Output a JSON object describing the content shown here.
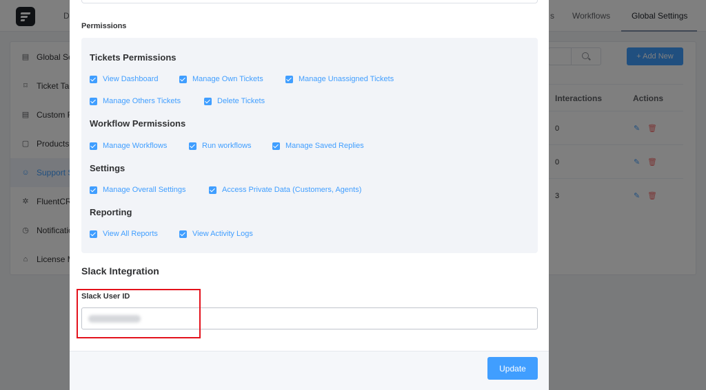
{
  "topnav": {
    "tabs": [
      {
        "label": "Da"
      },
      {
        "label": "s"
      },
      {
        "label": "Workflows"
      },
      {
        "label": "Global Settings"
      }
    ]
  },
  "sidebar": {
    "items": [
      {
        "label": "Global Se",
        "icon": "document-icon"
      },
      {
        "label": "Ticket Tag",
        "icon": "bookmark-icon"
      },
      {
        "label": "Custom F",
        "icon": "form-icon"
      },
      {
        "label": "Products",
        "icon": "box-icon"
      },
      {
        "label": "Support S",
        "icon": "user-icon"
      },
      {
        "label": "FluentCRM",
        "icon": "gear-icon"
      },
      {
        "label": "Notificatio",
        "icon": "alarm-icon"
      },
      {
        "label": "License M",
        "icon": "lock-icon"
      }
    ]
  },
  "toolbar": {
    "add_new_label": "+ Add New"
  },
  "table": {
    "headers": [
      "Interactions",
      "Actions"
    ],
    "rows": [
      {
        "interactions": "0"
      },
      {
        "interactions": "0"
      },
      {
        "interactions": "3"
      }
    ]
  },
  "modal": {
    "permissions_label": "Permissions",
    "groups": [
      {
        "title": "Tickets Permissions",
        "items": [
          "View Dashboard",
          "Manage Own Tickets",
          "Manage Unassigned Tickets",
          "Manage Others Tickets",
          "Delete Tickets"
        ]
      },
      {
        "title": "Workflow Permissions",
        "items": [
          "Manage Workflows",
          "Run workflows",
          "Manage Saved Replies"
        ]
      },
      {
        "title": "Settings",
        "items": [
          "Manage Overall Settings",
          "Access Private Data (Customers, Agents)"
        ]
      },
      {
        "title": "Reporting",
        "items": [
          "View All Reports",
          "View Activity Logs"
        ]
      }
    ],
    "slack_title": "Slack Integration",
    "slack_label": "Slack User ID",
    "update_label": "Update"
  },
  "colors": {
    "primary": "#409eff",
    "highlight": "#e3111b",
    "danger": "#f56c6c"
  }
}
